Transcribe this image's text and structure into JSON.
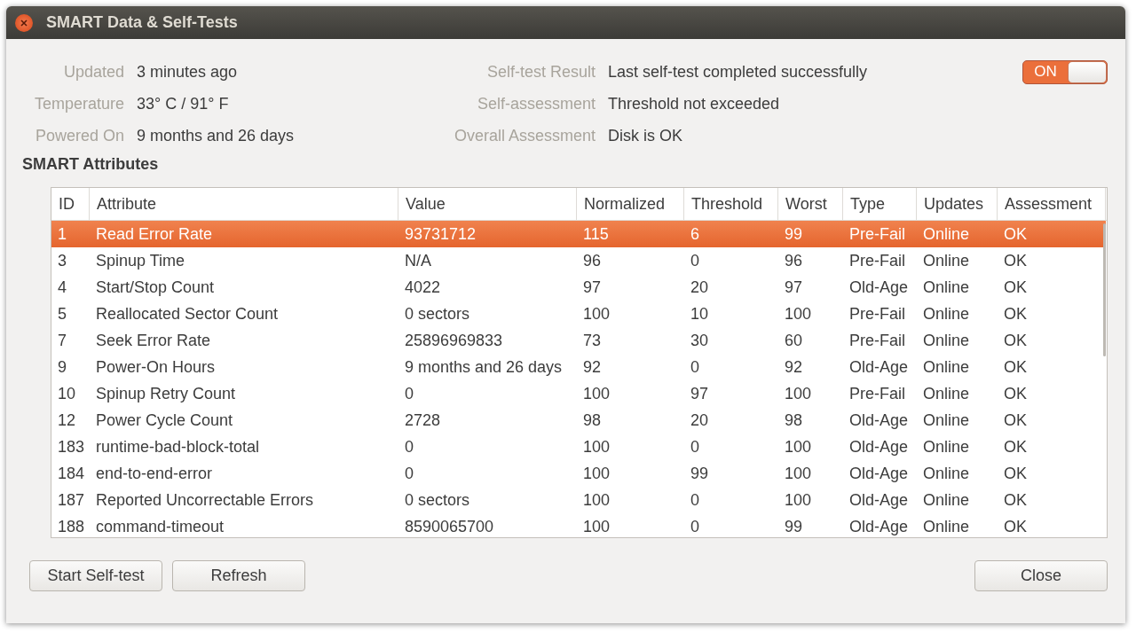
{
  "window": {
    "title": "SMART Data & Self-Tests"
  },
  "info_left": [
    {
      "label": "Updated",
      "value": "3 minutes ago"
    },
    {
      "label": "Temperature",
      "value": "33° C / 91° F"
    },
    {
      "label": "Powered On",
      "value": "9 months and 26 days"
    }
  ],
  "info_right": [
    {
      "label": "Self-test Result",
      "value": "Last self-test completed successfully"
    },
    {
      "label": "Self-assessment",
      "value": "Threshold not exceeded"
    },
    {
      "label": "Overall Assessment",
      "value": "Disk is OK"
    }
  ],
  "switch": {
    "label": "ON",
    "on": true
  },
  "section_title": "SMART Attributes",
  "table": {
    "columns": [
      "ID",
      "Attribute",
      "Value",
      "Normalized",
      "Threshold",
      "Worst",
      "Type",
      "Updates",
      "Assessment"
    ],
    "rows": [
      {
        "cells": [
          "1",
          "Read Error Rate",
          "93731712",
          "115",
          "6",
          "99",
          "Pre-Fail",
          "Online",
          "OK"
        ],
        "selected": true
      },
      {
        "cells": [
          "3",
          "Spinup Time",
          "N/A",
          "96",
          "0",
          "96",
          "Pre-Fail",
          "Online",
          "OK"
        ],
        "selected": false
      },
      {
        "cells": [
          "4",
          "Start/Stop Count",
          "4022",
          "97",
          "20",
          "97",
          "Old-Age",
          "Online",
          "OK"
        ],
        "selected": false
      },
      {
        "cells": [
          "5",
          "Reallocated Sector Count",
          "0 sectors",
          "100",
          "10",
          "100",
          "Pre-Fail",
          "Online",
          "OK"
        ],
        "selected": false
      },
      {
        "cells": [
          "7",
          "Seek Error Rate",
          "25896969833",
          "73",
          "30",
          "60",
          "Pre-Fail",
          "Online",
          "OK"
        ],
        "selected": false
      },
      {
        "cells": [
          "9",
          "Power-On Hours",
          "9 months and 26 days",
          "92",
          "0",
          "92",
          "Old-Age",
          "Online",
          "OK"
        ],
        "selected": false
      },
      {
        "cells": [
          "10",
          "Spinup Retry Count",
          "0",
          "100",
          "97",
          "100",
          "Pre-Fail",
          "Online",
          "OK"
        ],
        "selected": false
      },
      {
        "cells": [
          "12",
          "Power Cycle Count",
          "2728",
          "98",
          "20",
          "98",
          "Old-Age",
          "Online",
          "OK"
        ],
        "selected": false
      },
      {
        "cells": [
          "183",
          "runtime-bad-block-total",
          "0",
          "100",
          "0",
          "100",
          "Old-Age",
          "Online",
          "OK"
        ],
        "selected": false
      },
      {
        "cells": [
          "184",
          "end-to-end-error",
          "0",
          "100",
          "99",
          "100",
          "Old-Age",
          "Online",
          "OK"
        ],
        "selected": false
      },
      {
        "cells": [
          "187",
          "Reported Uncorrectable Errors",
          "0 sectors",
          "100",
          "0",
          "100",
          "Old-Age",
          "Online",
          "OK"
        ],
        "selected": false
      },
      {
        "cells": [
          "188",
          "command-timeout",
          "8590065700",
          "100",
          "0",
          "99",
          "Old-Age",
          "Online",
          "OK"
        ],
        "selected": false
      }
    ]
  },
  "buttons_left": [
    "Start Self-test",
    "Refresh"
  ],
  "buttons_right": [
    "Close"
  ]
}
